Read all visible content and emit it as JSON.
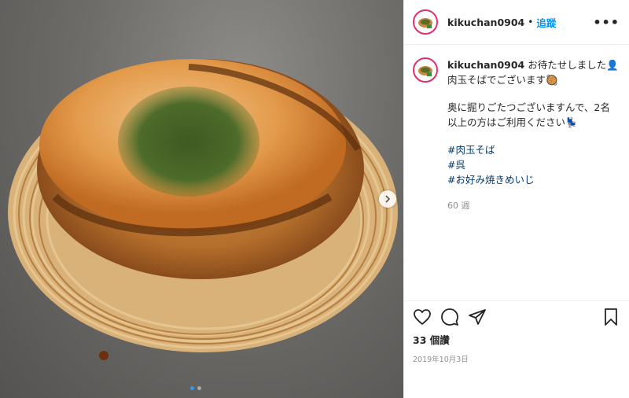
{
  "post": {
    "username": "kikuchan0904",
    "separator": "•",
    "follow_label": "追蹤",
    "more_label": "•••",
    "caption_line1": "お待たせしました",
    "caption_line1b": "肉玉そばでございます",
    "caption_para2": "奥に掘りごたつございますんで、2名以上の方はご利用ください",
    "hashtags": [
      "#肉玉そば",
      "#呉",
      "#お好み焼きめいじ"
    ],
    "comment_time": "60 週",
    "likes": "33 個讚",
    "date": "2019年10月3日"
  },
  "carousel": {
    "slides": 2,
    "active_index": 0
  },
  "icons": {
    "like": "heart-icon",
    "comment": "comment-icon",
    "share": "share-icon",
    "save": "bookmark-icon",
    "next": "chevron-right-icon"
  },
  "colors": {
    "link": "#0095f6",
    "hashtag": "#00376b",
    "avatar_ring": "#e1306c",
    "active_dot": "#3897f0"
  }
}
